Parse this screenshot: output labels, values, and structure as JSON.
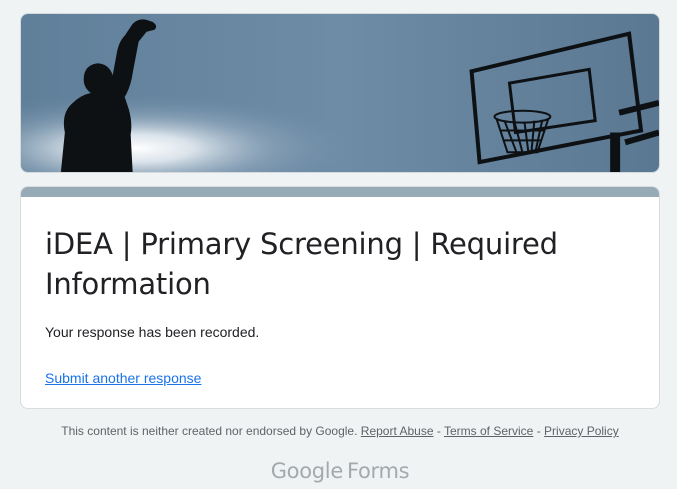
{
  "form": {
    "title": "iDEA | Primary Screening | Required Information",
    "confirmation_message": "Your response has been recorded.",
    "submit_another_label": "Submit another response"
  },
  "footer": {
    "disclaimer": "This content is neither created nor endorsed by Google.",
    "report_abuse_label": "Report Abuse",
    "separator": "-",
    "terms_label": "Terms of Service",
    "privacy_label": "Privacy Policy"
  },
  "branding": {
    "google": "Google",
    "forms": "Forms"
  },
  "colors": {
    "accent_bar": "#97abb7",
    "page_background": "#f0f3f4",
    "link": "#1a73e8"
  },
  "banner": {
    "image_description_icon": "basketball-player-silhouette-image"
  }
}
